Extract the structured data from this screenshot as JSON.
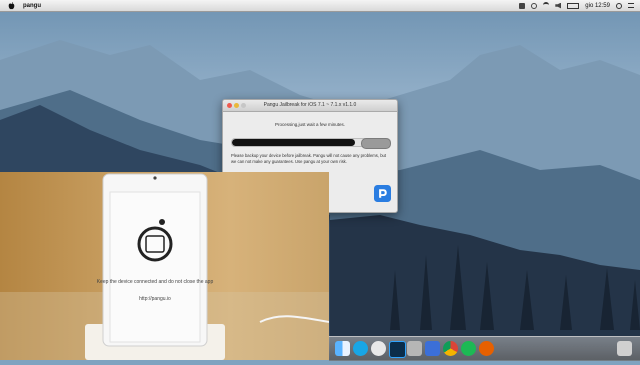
{
  "menubar": {
    "app_name": "pangu",
    "clock": "gio 12:59",
    "icon_names": [
      "apple-icon",
      "notification-icon",
      "status-icons",
      "wifi-icon",
      "volume-icon",
      "battery-icon",
      "search-icon",
      "list-icon"
    ]
  },
  "window": {
    "title": "Pangu Jailbreak for iOS 7.1 ~ 7.1.x  v1.1.0",
    "status": "Processing,just wait a few minutes.",
    "progress": 0.78,
    "note": "Please backup your device before jailbreak. Pangu will not cause any problems, but we can not make any guarantees. Use pangu at your own risk."
  },
  "phone_screen": {
    "message": "Keep the device connected and do not close the app",
    "url": "http://pangu.io"
  },
  "dock": {
    "icons": [
      "finder-icon",
      "skype-icon",
      "itunes-icon",
      "photoshop-icon",
      "safari-icon",
      "downloads-icon",
      "chrome-icon",
      "spotify-icon",
      "firefox-icon",
      "bin-icon"
    ]
  },
  "colors": {
    "desktop_sky": "#7fa3c0",
    "window_bg": "#ececec",
    "accent_blue": "#2a7de1"
  }
}
